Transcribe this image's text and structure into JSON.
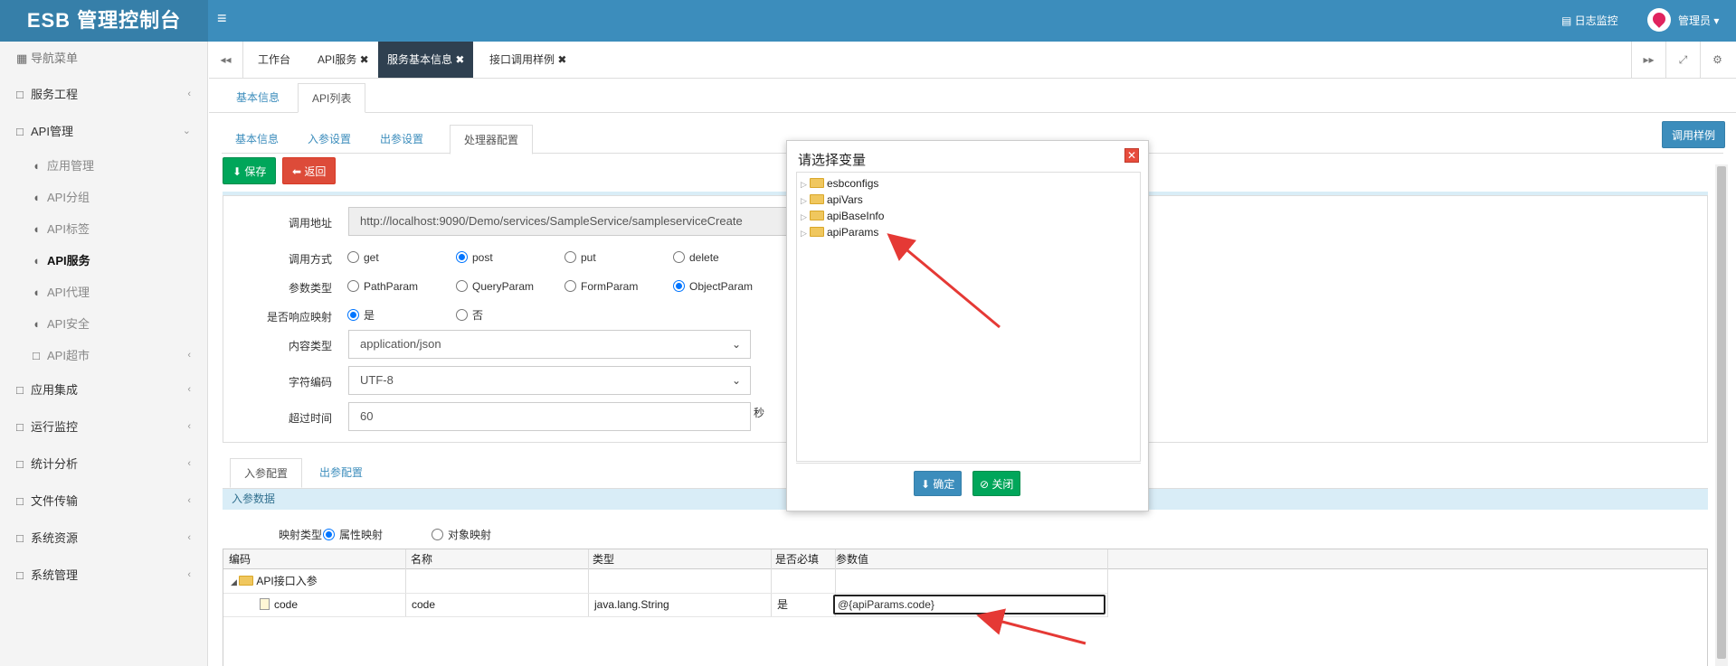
{
  "header": {
    "brand": "ESB 管理控制台",
    "menu_icon": "≡",
    "log_monitor": "日志监控",
    "user": "管理员 ▾"
  },
  "sidebar": {
    "title": "导航菜单",
    "items": [
      {
        "label": "服务工程"
      },
      {
        "label": "API管理"
      },
      {
        "label": "应用集成"
      },
      {
        "label": "运行监控"
      },
      {
        "label": "统计分析"
      },
      {
        "label": "文件传输"
      },
      {
        "label": "系统资源"
      },
      {
        "label": "系统管理"
      }
    ],
    "api_sub": [
      {
        "label": "应用管理"
      },
      {
        "label": "API分组"
      },
      {
        "label": "API标签"
      },
      {
        "label": "API服务"
      },
      {
        "label": "API代理"
      },
      {
        "label": "API安全"
      },
      {
        "label": "API超市"
      }
    ]
  },
  "tabs": [
    "工作台",
    "API服务 ✖",
    "服务基本信息 ✖",
    "接口调用样例 ✖"
  ],
  "sub_tabs": [
    "基本信息",
    "API列表"
  ],
  "api_tabs": [
    "基本信息",
    "入参设置",
    "出参设置",
    "处理器配置"
  ],
  "buttons": {
    "save": "保存",
    "back": "返回",
    "example": "调用样例"
  },
  "form": {
    "call_address_label": "调用地址",
    "call_address": "http://localhost:9090/Demo/services/SampleService/sampleserviceCreate",
    "call_method_label": "调用方式",
    "methods": [
      "get",
      "post",
      "put",
      "delete"
    ],
    "param_type_label": "参数类型",
    "param_types": [
      "PathParam",
      "QueryParam",
      "FormParam",
      "ObjectParam"
    ],
    "resp_map_label": "是否响应映射",
    "resp_map_options": [
      "是",
      "否"
    ],
    "content_type_label": "内容类型",
    "content_type": "application/json",
    "charset_label": "字符编码",
    "charset": "UTF-8",
    "timeout_label": "超过时间",
    "timeout": "60",
    "timeout_unit": "秒"
  },
  "lower_tabs": [
    "入参配置",
    "出参配置"
  ],
  "param_header": "入参数据",
  "mapping": {
    "label": "映射类型",
    "options": [
      "属性映射",
      "对象映射"
    ]
  },
  "grid": {
    "columns": [
      "编码",
      "名称",
      "类型",
      "是否必填",
      "参数值"
    ],
    "group": "API接口入参",
    "rows": [
      {
        "code": "code",
        "name": "code",
        "type": "java.lang.String",
        "required": "是",
        "value": "@{apiParams.code}"
      }
    ]
  },
  "modal": {
    "title": "请选择变量",
    "nodes": [
      "esbconfigs",
      "apiVars",
      "apiBaseInfo",
      "apiParams"
    ],
    "confirm": "确定",
    "close": "关闭"
  }
}
